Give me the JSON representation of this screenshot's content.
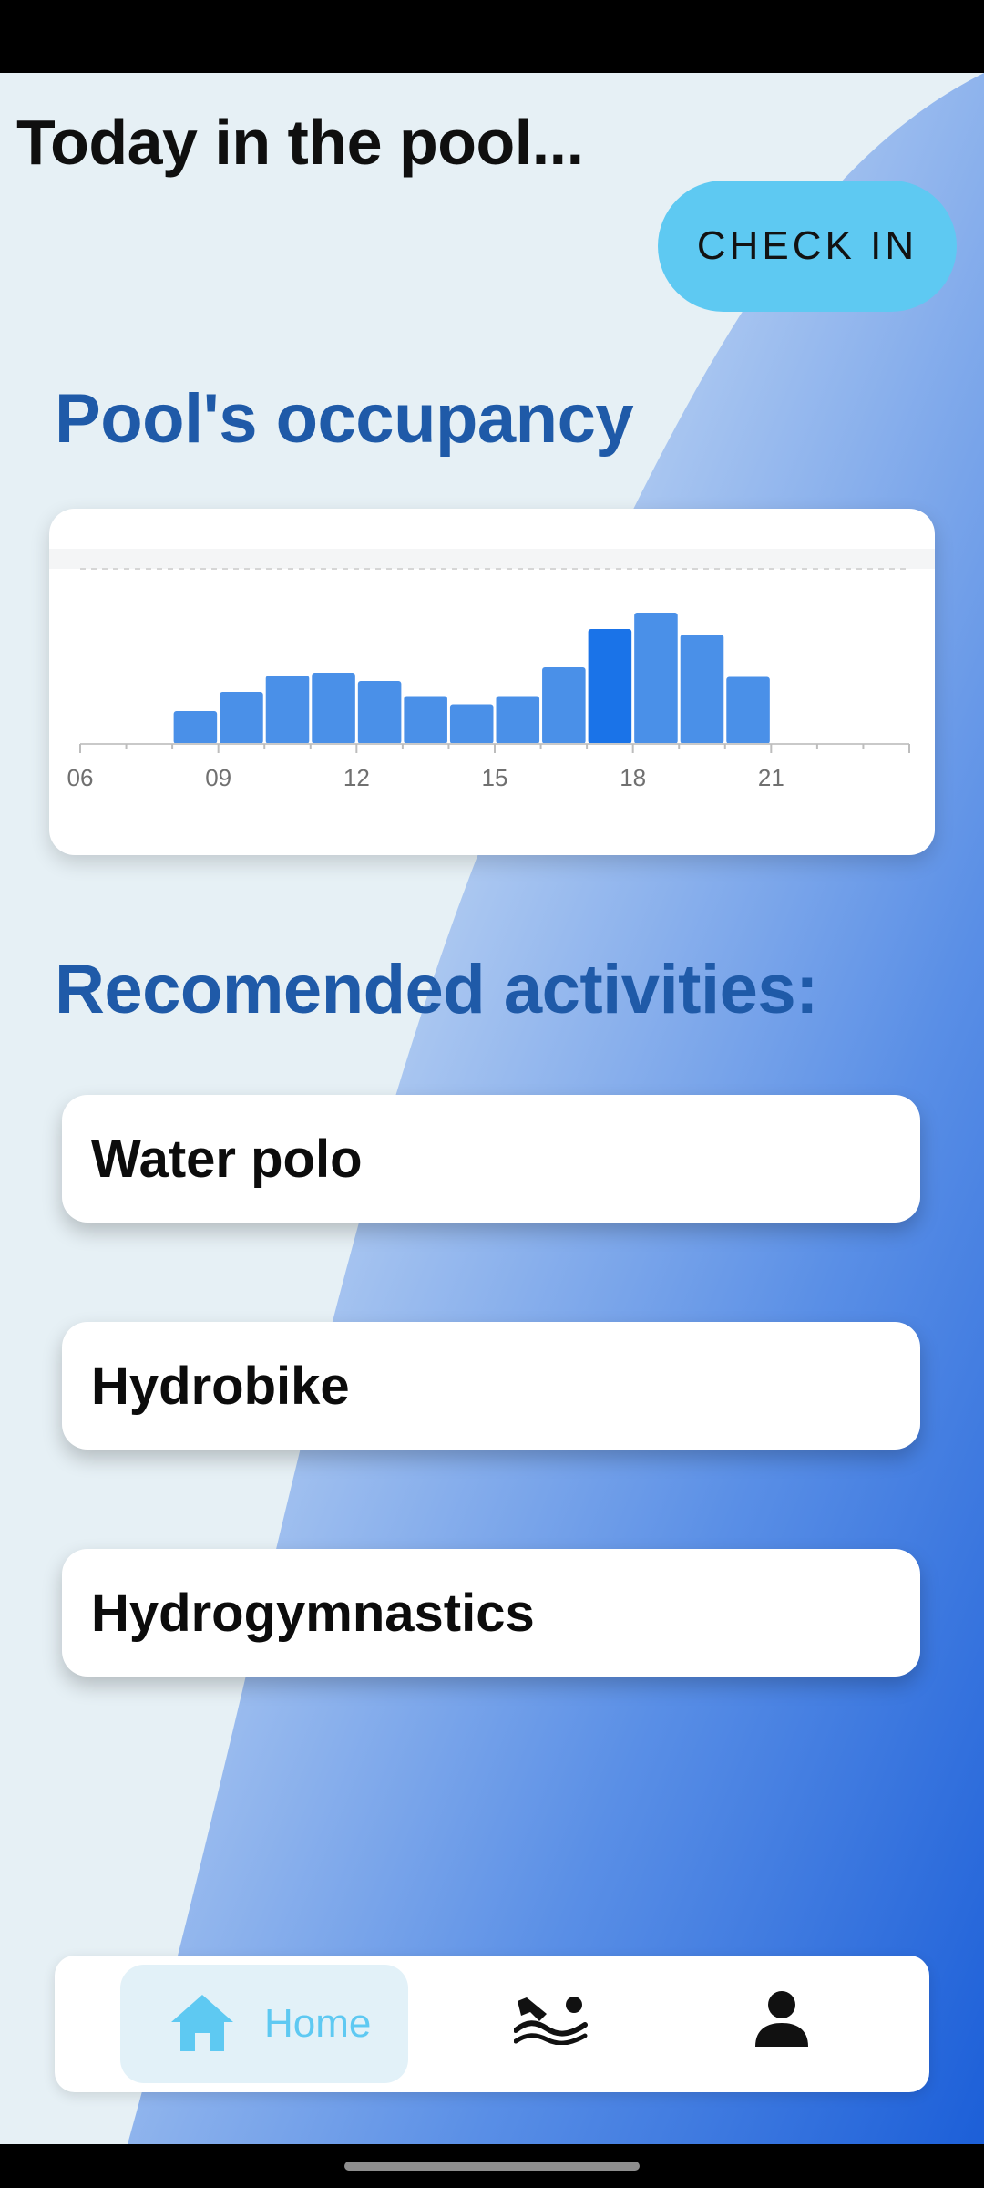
{
  "header": {
    "title": "Today in the pool...",
    "checkin_label": "CHECK IN"
  },
  "occupancy": {
    "section_title": "Pool's occupancy",
    "chart_data": {
      "type": "bar",
      "title": "",
      "xlabel": "",
      "ylabel": "",
      "x_ticks": [
        "06",
        "09",
        "12",
        "15",
        "18",
        "21"
      ],
      "x_range": [
        6,
        24
      ],
      "ylim": [
        0,
        100
      ],
      "highlight_color": "#1a73e8",
      "bar_color": "#4a90e8",
      "bars": [
        {
          "hour": 8,
          "value": 24
        },
        {
          "hour": 9,
          "value": 38
        },
        {
          "hour": 10,
          "value": 50
        },
        {
          "hour": 11,
          "value": 52
        },
        {
          "hour": 12,
          "value": 46
        },
        {
          "hour": 13,
          "value": 35
        },
        {
          "hour": 14,
          "value": 29
        },
        {
          "hour": 15,
          "value": 35
        },
        {
          "hour": 16,
          "value": 56
        },
        {
          "hour": 17,
          "value": 84,
          "highlight": true
        },
        {
          "hour": 18,
          "value": 96
        },
        {
          "hour": 19,
          "value": 80
        },
        {
          "hour": 20,
          "value": 49
        }
      ]
    }
  },
  "activities": {
    "section_title": "Recomended activities:",
    "items": [
      "Water polo",
      "Hydrobike",
      "Hydrogymnastics"
    ]
  },
  "bottom_nav": {
    "home_label": "Home",
    "icons": [
      "home-icon",
      "swimmer-icon",
      "person-icon"
    ],
    "accent": "#5ec9f2"
  }
}
